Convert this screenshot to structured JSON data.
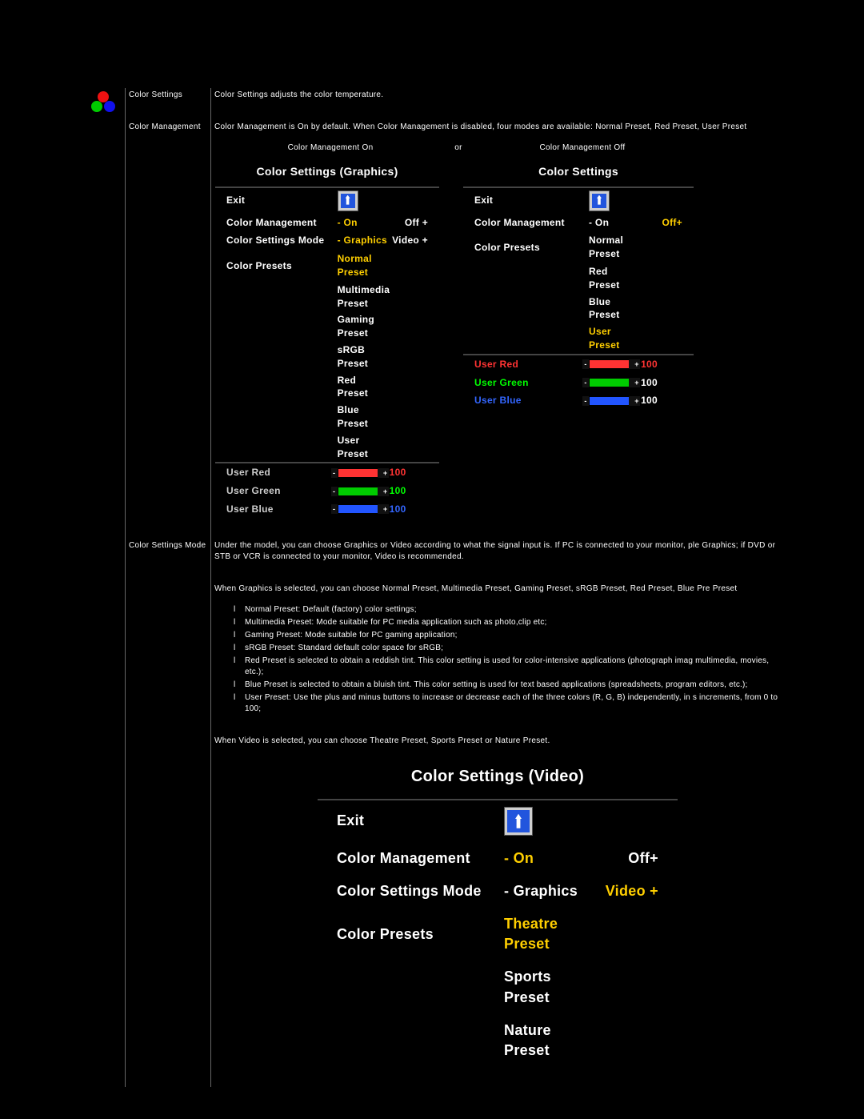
{
  "rows": {
    "color_settings": {
      "label": "Color Settings",
      "desc": "Color Settings adjusts the color temperature."
    },
    "color_management": {
      "label": "Color Management",
      "desc": "Color Management is On by default. When Color Management is disabled, four modes are available: Normal Preset, Red Preset, User Preset",
      "caption_on": "Color Management On",
      "caption_or": "or",
      "caption_off": "Color Management Off"
    },
    "color_settings_mode": {
      "label": "Color Settings Mode",
      "p1": "Under the model, you can choose Graphics or Video according to what the signal input is. If PC is connected to your monitor, ple Graphics; if DVD or STB or VCR is connected to your monitor, Video is recommended.",
      "p2": "When Graphics is selected, you can choose Normal Preset, Multimedia Preset, Gaming Preset, sRGB Preset, Red Preset, Blue Pre Preset",
      "bullets": [
        "Normal Preset: Default (factory) color settings;",
        "Multimedia Preset: Mode suitable for PC media application such as photo,clip etc;",
        "Gaming Preset: Mode suitable for PC gaming application;",
        "sRGB Preset:  Standard default color space for sRGB;",
        "Red Preset is selected to obtain a reddish tint. This color setting is used for color-intensive applications (photograph imag multimedia, movies, etc.);",
        "Blue Preset is selected to obtain a bluish tint. This color setting is used for text based applications (spreadsheets, program editors, etc.);",
        "User Preset: Use the plus and minus buttons to increase or decrease each of the three colors (R, G, B) independently, in s increments, from 0 to 100;"
      ],
      "p3": "When Video is selected, you can choose Theatre Preset, Sports Preset or Nature Preset."
    }
  },
  "osd_on": {
    "title": "Color Settings (Graphics)",
    "exit": "Exit",
    "cm": "Color Management",
    "cm_on": "- On",
    "cm_off": "Off +",
    "mode": "Color Settings Mode",
    "mode_g": "- Graphics",
    "mode_v": "Video +",
    "cp": "Color Presets",
    "presets": [
      "Normal Preset",
      "Multimedia Preset",
      "Gaming Preset",
      "sRGB Preset",
      "Red Preset",
      "Blue Preset",
      "User Preset"
    ],
    "ur": "User Red",
    "ur_v": "100",
    "ug": "User Green",
    "ug_v": "100",
    "ub": "User Blue",
    "ub_v": "100"
  },
  "osd_off": {
    "title": "Color Settings",
    "exit": "Exit",
    "cm": "Color Management",
    "cm_on": "- On",
    "cm_off": "Off+",
    "cp": "Color Presets",
    "presets": [
      "Normal Preset",
      "Red Preset",
      "Blue Preset",
      "User Preset"
    ],
    "ur": "User Red",
    "ur_v": "100",
    "ug": "User Green",
    "ug_v": "100",
    "ub": "User Blue",
    "ub_v": "100"
  },
  "osd_video": {
    "title": "Color Settings (Video)",
    "exit": "Exit",
    "cm": "Color Management",
    "cm_on": "- On",
    "cm_off": "Off+",
    "mode": "Color Settings Mode",
    "mode_g": "- Graphics",
    "mode_v": "Video +",
    "cp": "Color Presets",
    "presets": [
      "Theatre Preset",
      "Sports Preset",
      "Nature Preset"
    ]
  }
}
